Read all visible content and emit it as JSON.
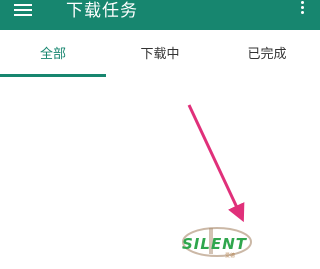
{
  "appbar": {
    "title": "下载任务",
    "menu_icon": "hamburger-menu-icon",
    "more_icon": "more-vert-icon",
    "background": "#17866f"
  },
  "tabs": [
    {
      "label": "全部",
      "active": true
    },
    {
      "label": "下载中",
      "active": false
    },
    {
      "label": "已完成",
      "active": false
    }
  ],
  "accent_color": "#17866f",
  "annotation": {
    "arrow_color": "#e0307a"
  },
  "watermark": {
    "text": "SILENT",
    "subtext": "爱德"
  }
}
